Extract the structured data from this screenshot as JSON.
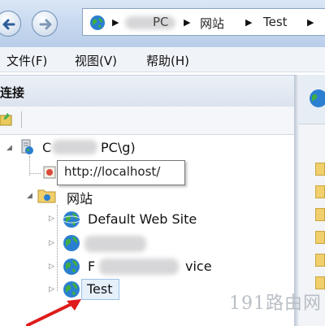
{
  "nav": {
    "breadcrumbs": [
      "PC",
      "网站",
      "Test"
    ]
  },
  "menu": {
    "items": [
      "文件(F)",
      "视图(V)",
      "帮助(H)"
    ]
  },
  "connections": {
    "title": "连接",
    "server_node": "PC\\g)",
    "tooltip": "http://localhost/",
    "sites_node": "网站",
    "sites": [
      "Default Web Site",
      "F",
      "vice",
      "Test"
    ]
  },
  "watermark": "191路由网",
  "colors": {
    "titlebar": "#c9daf0",
    "selection": "#e5f0fb",
    "globe": "#2a7fd0"
  },
  "icons": {
    "back": "back-arrow-icon",
    "forward": "forward-arrow-icon",
    "globe": "globe-icon",
    "folder": "folder-icon"
  }
}
